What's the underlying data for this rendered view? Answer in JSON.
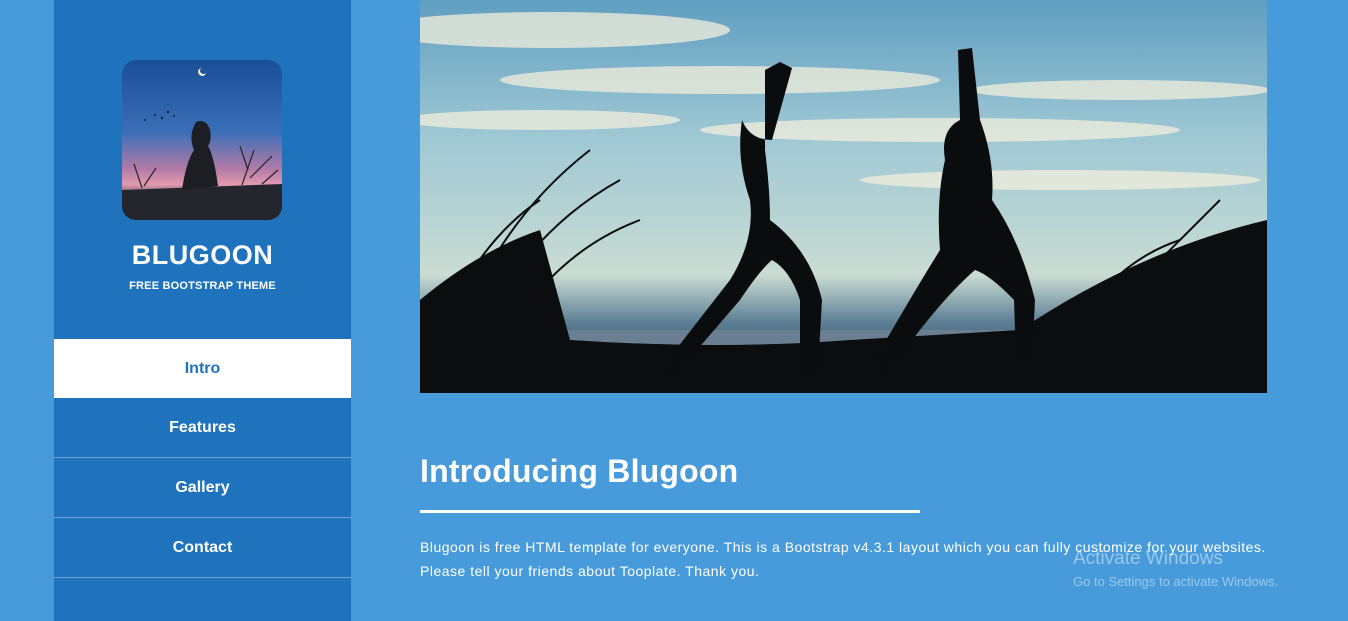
{
  "sidebar": {
    "brand": "BLUGOON",
    "tagline": "FREE BOOTSTRAP THEME",
    "nav": [
      {
        "label": "Intro",
        "active": true
      },
      {
        "label": "Features",
        "active": false
      },
      {
        "label": "Gallery",
        "active": false
      },
      {
        "label": "Contact",
        "active": false
      }
    ]
  },
  "main": {
    "title": "Introducing Blugoon",
    "paragraph": "Blugoon is free HTML template for everyone. This is a Bootstrap v4.3.1 layout which you can fully customize for your websites. Please tell your friends about Tooplate. Thank you."
  },
  "watermark": {
    "title": "Activate Windows",
    "subtitle": "Go to Settings to activate Windows."
  },
  "colors": {
    "page_bg": "#479bdb",
    "sidebar_bg": "#1f73bd",
    "active_nav_bg": "#ffffff",
    "active_nav_text": "#1f73bd"
  }
}
